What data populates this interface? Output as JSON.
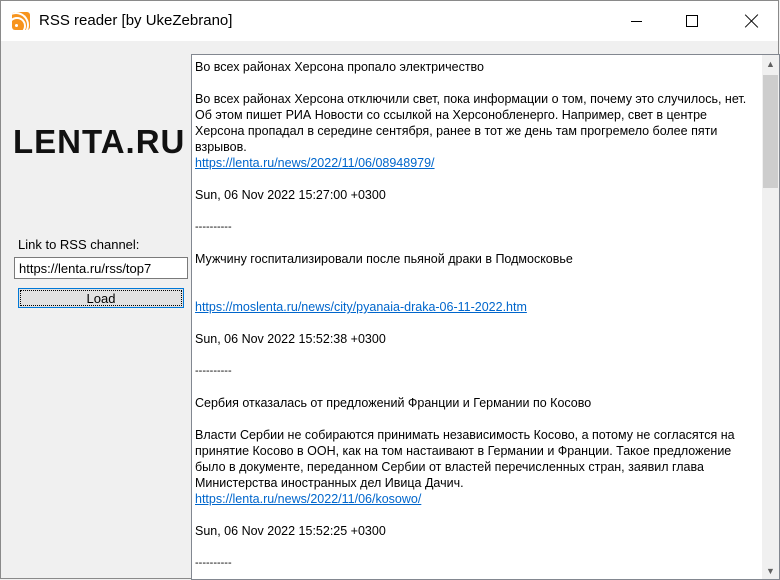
{
  "window": {
    "title": "RSS reader [by UkeZebrano]",
    "icon": "rss-icon",
    "controls": [
      "minimize-icon",
      "maximize-icon",
      "close-icon"
    ]
  },
  "sidebar": {
    "logo_text": "LENTA.RU",
    "rss_label": "Link to RSS channel:",
    "rss_value": "https://lenta.ru/rss/top7",
    "load_label": "Load"
  },
  "feed": {
    "items": [
      {
        "title": "Во всех районах Херсона пропало электричество",
        "description": "Во всех районах Херсона отключили свет, пока информации о том, почему это случилось, нет. Об этом пишет РИА Новости со ссылкой на Херсонобленерго. Например, свет в центре Херсона пропадал в середине сентября, ранее в тот же день там прогремело более пяти взрывов.",
        "link": "https://lenta.ru/news/2022/11/06/08948979/",
        "date": "Sun, 06 Nov 2022 15:27:00 +0300",
        "separator": "----------"
      },
      {
        "title": "Мужчину госпитализировали после пьяной драки в Подмосковье",
        "description": "",
        "link": "https://moslenta.ru/news/city/pyanaia-draka-06-11-2022.htm",
        "date": "Sun, 06 Nov 2022 15:52:38 +0300",
        "separator": "----------"
      },
      {
        "title": "Сербия отказалась от предложений Франции и Германии по Косово",
        "description": "Власти Сербии не собираются принимать независимость Косово, а потому не согласятся на принятие Косово в ООН, как на том настаивают в Германии и Франции. Такое предложение было в документе, переданном Сербии от властей перечисленных стран, заявил глава Министерства иностранных дел Ивица Дачич.",
        "link": "https://lenta.ru/news/2022/11/06/kosowo/",
        "date": "Sun, 06 Nov 2022 15:52:25 +0300",
        "separator": "----------"
      }
    ]
  },
  "scrollbar": {
    "up_icon": "scroll-up-arrow-icon",
    "down_icon": "scroll-down-arrow-icon",
    "position": 0.0
  }
}
